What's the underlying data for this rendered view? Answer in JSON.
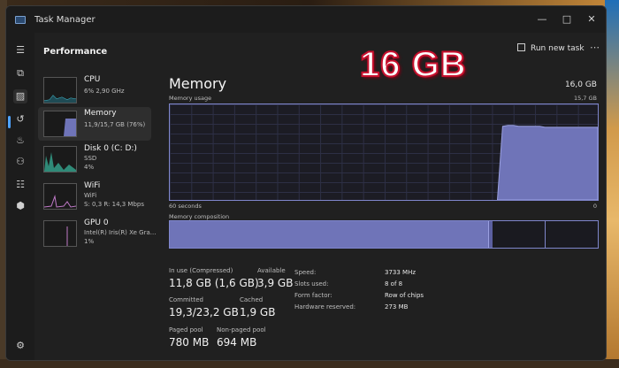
{
  "window": {
    "title": "Task Manager",
    "minimize": "—",
    "maximize": "□",
    "close": "✕"
  },
  "header": {
    "title": "Performance",
    "run_new_task": "Run new task",
    "more": "⋯"
  },
  "rail": [
    "☰",
    "⧉",
    "▨",
    "↺",
    "♨",
    "⚇",
    "☷",
    "⬢",
    "⚙"
  ],
  "sidebar": {
    "items": [
      {
        "name": "CPU",
        "line1": "6% 2,90 GHz",
        "line2": ""
      },
      {
        "name": "Memory",
        "line1": "11,9/15,7 GB (76%)",
        "line2": ""
      },
      {
        "name": "Disk 0 (C: D:)",
        "line1": "SSD",
        "line2": "4%"
      },
      {
        "name": "WiFi",
        "line1": "WiFi",
        "line2": "S: 0,3  R: 14,3 Mbps"
      },
      {
        "name": "GPU 0",
        "line1": "Intel(R) Iris(R) Xe Gra...",
        "line2": "1%"
      }
    ]
  },
  "memory": {
    "title": "Memory",
    "total": "16,0 GB",
    "usage_label": "Memory usage",
    "usage_max": "15,7 GB",
    "time_left": "60 seconds",
    "time_right": "0",
    "composition_label": "Memory composition",
    "in_use_fraction": 0.745,
    "history": [
      0,
      0,
      0,
      0,
      0,
      0,
      0,
      0,
      0,
      0,
      0,
      0,
      0,
      0,
      0,
      0,
      0,
      0,
      0,
      0,
      0,
      0,
      0,
      0,
      0,
      0,
      0,
      0,
      0,
      0,
      0,
      0,
      0,
      0,
      0,
      0,
      0,
      0,
      0,
      0,
      0,
      0,
      0,
      0,
      0,
      0,
      0,
      0,
      0,
      0,
      0,
      0,
      0,
      0,
      0,
      0,
      0,
      0,
      0,
      0,
      0,
      0,
      0,
      0.77,
      0.78,
      0.78,
      0.77,
      0.77,
      0.77,
      0.77,
      0.77,
      0.76,
      0.76,
      0.76,
      0.76,
      0.76,
      0.76,
      0.76,
      0.76,
      0.76,
      0.76,
      0.76
    ]
  },
  "stats": {
    "in_use_label": "In use (Compressed)",
    "in_use": "11,8 GB (1,6 GB)",
    "available_label": "Available",
    "available": "3,9 GB",
    "committed_label": "Committed",
    "committed": "19,3/23,2 GB",
    "cached_label": "Cached",
    "cached": "1,9 GB",
    "paged_label": "Paged pool",
    "paged": "780 MB",
    "nonpaged_label": "Non-paged pool",
    "nonpaged": "694 MB"
  },
  "details": {
    "speed_label": "Speed:",
    "speed": "3733 MHz",
    "slots_label": "Slots used:",
    "slots": "8 of 8",
    "form_label": "Form factor:",
    "form": "Row of chips",
    "reserved_label": "Hardware reserved:",
    "reserved": "273 MB"
  },
  "overlay_text": "16 GB",
  "colors": {
    "accent": "#7f86cc",
    "fill": "#6f74b8",
    "rail_active": "#4ea3ff"
  }
}
